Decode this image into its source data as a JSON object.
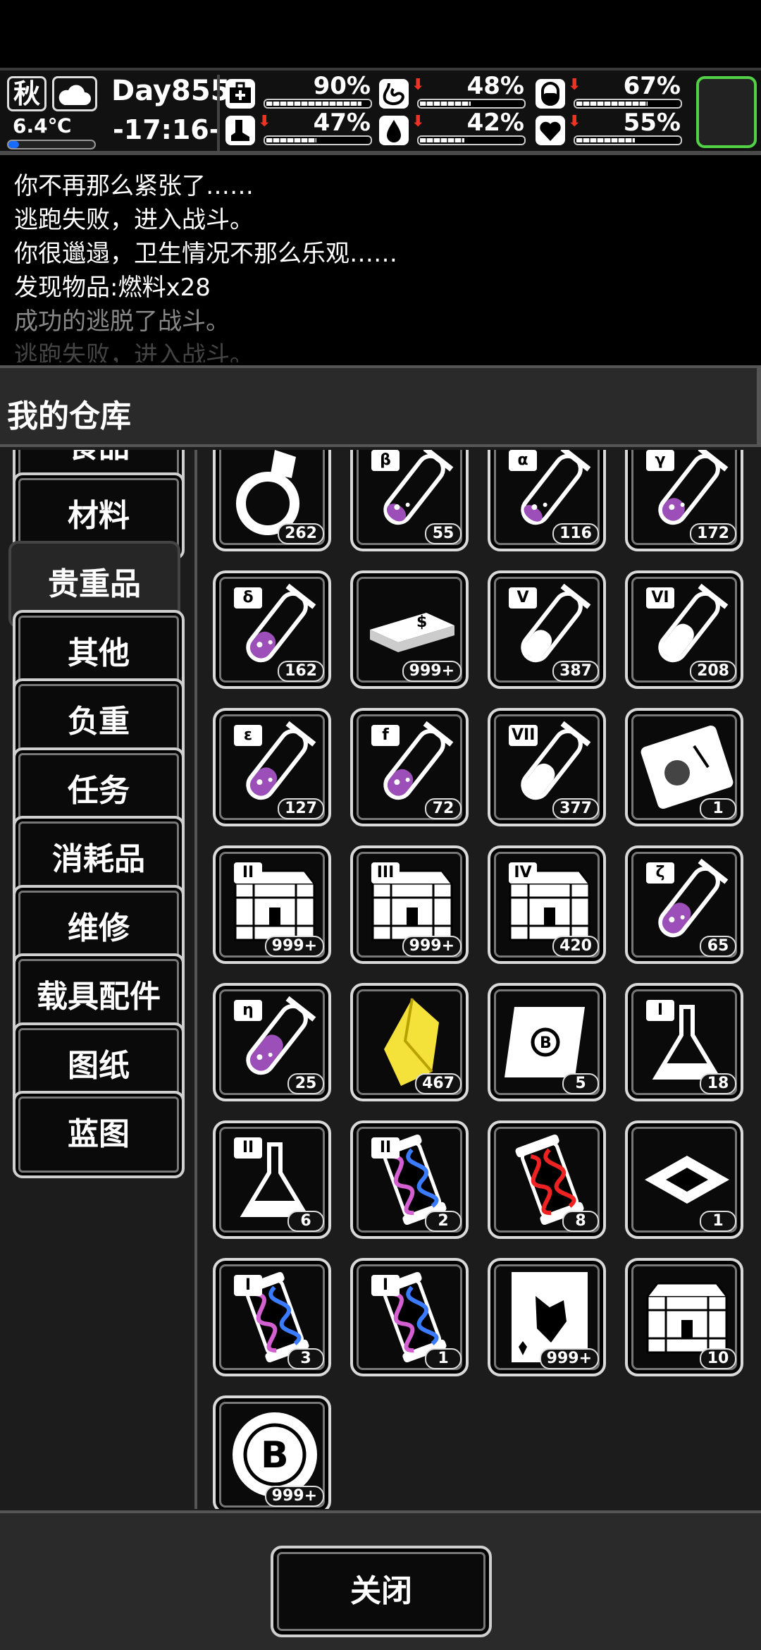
{
  "status": {
    "season": "秋",
    "weather_icon": "cloud-icon",
    "temperature": "6.4℃",
    "temperature_level": 0.12,
    "day": "Day855",
    "clock": "-17:16-",
    "stats": [
      {
        "icon": "medkit-icon",
        "value": "90%",
        "level": 0.9,
        "trend": ""
      },
      {
        "icon": "stomach-icon",
        "value": "48%",
        "level": 0.48,
        "trend": "down"
      },
      {
        "icon": "capsule-icon",
        "value": "67%",
        "level": 0.67,
        "trend": "down"
      },
      {
        "icon": "boot-icon",
        "value": "47%",
        "level": 0.47,
        "trend": "down"
      },
      {
        "icon": "water-drop-icon",
        "value": "42%",
        "level": 0.42,
        "trend": "down"
      },
      {
        "icon": "heart-icon",
        "value": "55%",
        "level": 0.55,
        "trend": "down"
      }
    ],
    "accent_color": "#52d146"
  },
  "log": [
    {
      "text": "你不再那么紧张了……"
    },
    {
      "text": "逃跑失败，进入战斗。"
    },
    {
      "text": "你很邋遢，卫生情况不那么乐观……"
    },
    {
      "text": "发现物品:燃料x28"
    },
    {
      "text": "成功的逃脱了战斗。"
    },
    {
      "text": "逃跑失败，进入战斗。"
    }
  ],
  "warehouse": {
    "title": "我的仓库",
    "categories": [
      {
        "label": "食品"
      },
      {
        "label": "材料"
      },
      {
        "label": "贵重品",
        "selected": true
      },
      {
        "label": "其他"
      },
      {
        "label": "负重"
      },
      {
        "label": "任务"
      },
      {
        "label": "消耗品"
      },
      {
        "label": "维修"
      },
      {
        "label": "载具配件"
      },
      {
        "label": "图纸"
      },
      {
        "label": "蓝图"
      }
    ],
    "items": [
      {
        "icon": "ring-icon",
        "tag": "",
        "count": "262"
      },
      {
        "icon": "test-tube-icon",
        "tag": "β",
        "count": "55",
        "fill": 0.3
      },
      {
        "icon": "test-tube-icon",
        "tag": "α",
        "count": "116",
        "fill": 0.25
      },
      {
        "icon": "test-tube-icon",
        "tag": "γ",
        "count": "172",
        "fill": 0.45
      },
      {
        "icon": "test-tube-icon",
        "tag": "δ",
        "count": "162",
        "fill": 0.55
      },
      {
        "icon": "cash-stack-icon",
        "tag": "",
        "count": "999+"
      },
      {
        "icon": "test-tube-icon",
        "tag": "V",
        "count": "387",
        "fill": 0.6,
        "white": true
      },
      {
        "icon": "test-tube-icon",
        "tag": "VI",
        "count": "208",
        "fill": 0.75,
        "white": true
      },
      {
        "icon": "test-tube-icon",
        "tag": "ε",
        "count": "127",
        "fill": 0.6
      },
      {
        "icon": "test-tube-icon",
        "tag": "f",
        "count": "72",
        "fill": 0.55
      },
      {
        "icon": "test-tube-icon",
        "tag": "VII",
        "count": "377",
        "fill": 0.7,
        "white": true
      },
      {
        "icon": "ticket-icon",
        "tag": "",
        "count": "1"
      },
      {
        "icon": "crate-icon",
        "tag": "II",
        "count": "999+"
      },
      {
        "icon": "crate-icon",
        "tag": "III",
        "count": "999+"
      },
      {
        "icon": "crate-icon",
        "tag": "IV",
        "count": "420"
      },
      {
        "icon": "test-tube-icon",
        "tag": "ζ",
        "count": "65",
        "fill": 0.65
      },
      {
        "icon": "test-tube-icon",
        "tag": "η",
        "count": "25",
        "fill": 0.8
      },
      {
        "icon": "yellow-crystal-icon",
        "tag": "",
        "count": "467"
      },
      {
        "icon": "scroll-icon",
        "tag": "",
        "count": "5"
      },
      {
        "icon": "flask-icon",
        "tag": "I",
        "count": "18"
      },
      {
        "icon": "flask-icon",
        "tag": "II",
        "count": "6"
      },
      {
        "icon": "dna-capsule-icon",
        "tag": "II",
        "count": "2"
      },
      {
        "icon": "dna-capsule-red-icon",
        "tag": "",
        "count": "8"
      },
      {
        "icon": "microchip-icon",
        "tag": "",
        "count": "1"
      },
      {
        "icon": "dna-capsule-icon",
        "tag": "I",
        "count": "3"
      },
      {
        "icon": "dna-capsule-icon",
        "tag": "I",
        "count": "1"
      },
      {
        "icon": "zombie-card-icon",
        "tag": "",
        "count": "999+"
      },
      {
        "icon": "crate-icon",
        "tag": "",
        "count": "10"
      },
      {
        "icon": "bitcoin-chip-icon",
        "tag": "",
        "count": "999+"
      }
    ]
  },
  "footer": {
    "close_label": "关闭"
  }
}
